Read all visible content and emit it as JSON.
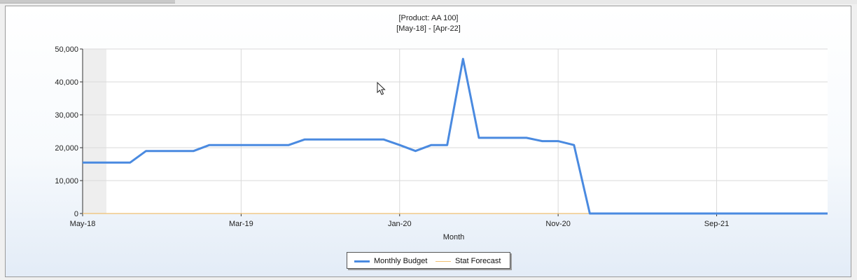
{
  "chart_data": {
    "type": "line",
    "title": "[Product: AA 100]",
    "subtitle": "[May-18] - [Apr-22]",
    "xlabel": "Month",
    "ylabel": "",
    "ylim": [
      0,
      50000
    ],
    "y_ticks": [
      0,
      10000,
      20000,
      30000,
      40000,
      50000
    ],
    "y_tick_labels": [
      "0",
      "10,000",
      "20,000",
      "30,000",
      "40,000",
      "50,000"
    ],
    "x_tick_labels": [
      "May-18",
      "Mar-19",
      "Jan-20",
      "Nov-20",
      "Sep-21"
    ],
    "x_tick_positions": [
      0,
      10,
      20,
      30,
      40
    ],
    "x": [
      "May-18",
      "Jun-18",
      "Jul-18",
      "Aug-18",
      "Sep-18",
      "Oct-18",
      "Nov-18",
      "Dec-18",
      "Jan-19",
      "Feb-19",
      "Mar-19",
      "Apr-19",
      "May-19",
      "Jun-19",
      "Jul-19",
      "Aug-19",
      "Sep-19",
      "Oct-19",
      "Nov-19",
      "Dec-19",
      "Jan-20",
      "Feb-20",
      "Mar-20",
      "Apr-20",
      "May-20",
      "Jun-20",
      "Jul-20",
      "Aug-20",
      "Sep-20",
      "Oct-20",
      "Nov-20",
      "Dec-20",
      "Jan-21",
      "Feb-21",
      "Mar-21",
      "Apr-21",
      "May-21",
      "Jun-21",
      "Jul-21",
      "Aug-21",
      "Sep-21",
      "Oct-21",
      "Nov-21",
      "Dec-21",
      "Jan-22",
      "Feb-22",
      "Mar-22",
      "Apr-22"
    ],
    "series": [
      {
        "name": "Monthly Budget",
        "color": "#4a8ae0",
        "values": [
          15500,
          15500,
          15500,
          15500,
          19000,
          19000,
          19000,
          19000,
          20800,
          20800,
          20800,
          20800,
          20800,
          20800,
          22500,
          22500,
          22500,
          22500,
          22500,
          22500,
          20800,
          19000,
          20800,
          20800,
          47000,
          23000,
          23000,
          23000,
          23000,
          22000,
          22000,
          20800,
          0,
          0,
          0,
          0,
          0,
          0,
          0,
          0,
          0,
          0,
          0,
          0,
          0,
          0,
          0,
          0
        ]
      },
      {
        "name": "Stat Forecast",
        "color": "#f0c070",
        "values": [
          0,
          0,
          0,
          0,
          0,
          0,
          0,
          0,
          0,
          0,
          0,
          0,
          0,
          0,
          0,
          0,
          0,
          0,
          0,
          0,
          0,
          0,
          0,
          0,
          0,
          0,
          0,
          0,
          0,
          0,
          0,
          0,
          0,
          0,
          0,
          0,
          0,
          0,
          0,
          0,
          0,
          0,
          0,
          0,
          0,
          0,
          0,
          0
        ]
      }
    ],
    "shaded_band_x": [
      0,
      1.5
    ],
    "grid": true,
    "legend_position": "bottom-center"
  },
  "legend": {
    "items": [
      {
        "label": "Monthly Budget",
        "color": "#4a8ae0"
      },
      {
        "label": "Stat Forecast",
        "color": "#f0c070"
      }
    ]
  }
}
